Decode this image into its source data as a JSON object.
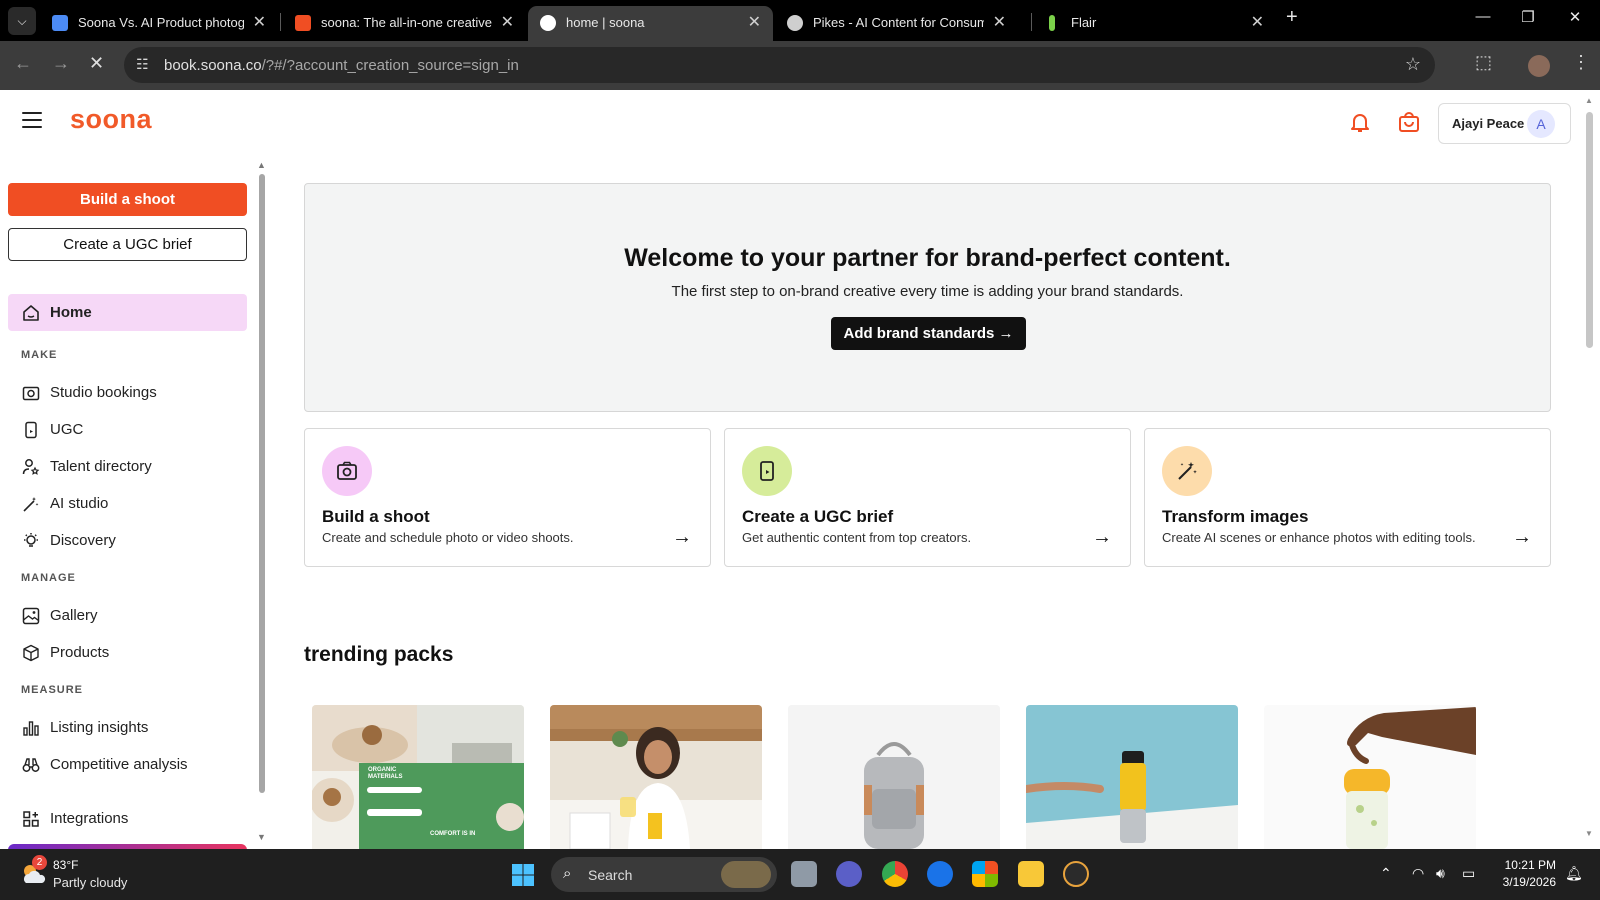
{
  "browser": {
    "tabs": [
      {
        "title": "Soona Vs. AI Product photograp",
        "favicon_color": "#4c8bf5"
      },
      {
        "title": "soona: The all-in-one creative p",
        "favicon_color": "#f04e23"
      },
      {
        "title": "home | soona",
        "favicon_color": "#ffffff"
      },
      {
        "title": "Pikes - AI Content for Consume",
        "favicon_color": "#cfcfcf"
      },
      {
        "title": "Flair",
        "favicon_color": "#7bd14a"
      }
    ],
    "url_host": "book.soona.co",
    "url_path": "/?#/?account_creation_source=sign_in"
  },
  "header": {
    "logo": "soona",
    "user_name": "Ajayi Peace",
    "user_initial": "A"
  },
  "sidebar": {
    "build_shoot": "Build a shoot",
    "create_ugc": "Create a UGC brief",
    "home": "Home",
    "sections": {
      "make": "MAKE",
      "manage": "MANAGE",
      "measure": "MEASURE"
    },
    "make_items": [
      "Studio bookings",
      "UGC",
      "Talent directory",
      "AI studio",
      "Discovery"
    ],
    "manage_items": [
      "Gallery",
      "Products"
    ],
    "measure_items": [
      "Listing insights",
      "Competitive analysis"
    ],
    "integrations": "Integrations"
  },
  "welcome": {
    "title": "Welcome to your partner for brand-perfect content.",
    "subtitle": "The first step to on-brand creative every time is adding your brand standards.",
    "button": "Add brand standards"
  },
  "cards": [
    {
      "title": "Build a shoot",
      "desc": "Create and schedule photo or video shoots.",
      "icon": "camera-icon",
      "color": "#f6c9f7"
    },
    {
      "title": "Create a UGC brief",
      "desc": "Get authentic content from top creators.",
      "icon": "phone-icon",
      "color": "#d6ec9a"
    },
    {
      "title": "Transform images",
      "desc": "Create AI scenes or enhance photos with editing tools.",
      "icon": "magic-wand-icon",
      "color": "#fddcab"
    }
  ],
  "trending": {
    "title": "trending packs",
    "pack1_text": {
      "organic": "ORGANIC MATERIALS",
      "comfort": "COMFORT IS IN"
    }
  },
  "taskbar": {
    "weather_badge": "2",
    "temp": "83°F",
    "weather": "Partly cloudy",
    "search": "Search",
    "time": "10:21 PM",
    "date": "3/19/2026"
  }
}
